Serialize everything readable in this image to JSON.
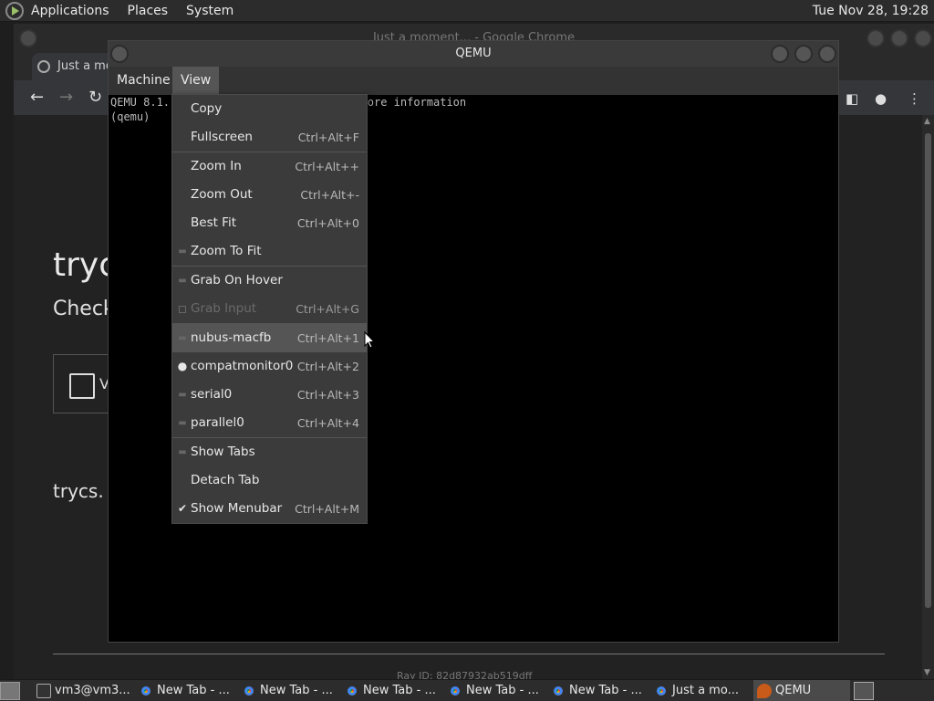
{
  "top_panel": {
    "menus": [
      "Applications",
      "Places",
      "System"
    ],
    "clock": "Tue Nov 28, 19:28"
  },
  "chrome": {
    "window_title": "Just a moment... - Google Chrome",
    "tab_title": "Just a mo",
    "page": {
      "heading": "tryc",
      "subheading": "Check",
      "checkbox_text": "V",
      "footer": "trycs.",
      "ray_id": "Ray ID: 82d87932ab519dff"
    }
  },
  "qemu": {
    "title": "QEMU",
    "menubar": [
      "Machine",
      "View"
    ],
    "console_lines": [
      "QEMU 8.1.                          or more information",
      "(qemu)"
    ]
  },
  "view_menu": {
    "items": [
      {
        "label": "Copy",
        "accel": ""
      },
      {
        "label": "Fullscreen",
        "accel": "Ctrl+Alt+F"
      },
      {
        "label": "Zoom In",
        "accel": "Ctrl+Alt++"
      },
      {
        "label": "Zoom Out",
        "accel": "Ctrl+Alt+-"
      },
      {
        "label": "Best Fit",
        "accel": "Ctrl+Alt+0"
      },
      {
        "label": "Zoom To Fit",
        "accel": ""
      },
      {
        "label": "Grab On Hover",
        "accel": ""
      },
      {
        "label": "Grab Input",
        "accel": "Ctrl+Alt+G"
      },
      {
        "label": "nubus-macfb",
        "accel": "Ctrl+Alt+1"
      },
      {
        "label": "compatmonitor0",
        "accel": "Ctrl+Alt+2"
      },
      {
        "label": "serial0",
        "accel": "Ctrl+Alt+3"
      },
      {
        "label": "parallel0",
        "accel": "Ctrl+Alt+4"
      },
      {
        "label": "Show Tabs",
        "accel": ""
      },
      {
        "label": "Detach Tab",
        "accel": ""
      },
      {
        "label": "Show Menubar",
        "accel": "Ctrl+Alt+M"
      }
    ]
  },
  "taskbar": {
    "items": [
      {
        "label": "vm3@vm3..."
      },
      {
        "label": "New Tab - ..."
      },
      {
        "label": "New Tab - ..."
      },
      {
        "label": "New Tab - ..."
      },
      {
        "label": "New Tab - ..."
      },
      {
        "label": "New Tab - ..."
      },
      {
        "label": "Just a mo..."
      },
      {
        "label": "QEMU"
      }
    ]
  },
  "colors": {
    "panel": "#2c2c2c",
    "menu_bg": "#3b3b3b",
    "highlight": "#555555",
    "disabled_text": "#6a6a6a"
  }
}
